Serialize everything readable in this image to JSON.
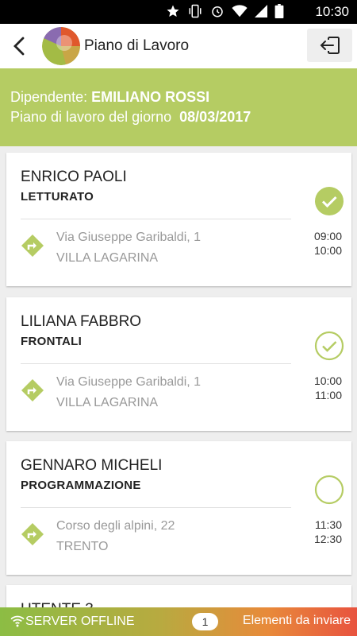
{
  "status_bar": {
    "time": "10:30"
  },
  "app_bar": {
    "title": "Piano di Lavoro"
  },
  "header": {
    "employee_label": "Dipendente:",
    "employee_name": "EMILIANO ROSSI",
    "plan_label": "Piano di lavoro del giorno",
    "plan_date": "08/03/2017"
  },
  "appointments": [
    {
      "name": "ENRICO PAOLI",
      "type": "LETTURATO",
      "street": "Via Giuseppe Garibaldi, 1",
      "city": "VILLA LAGARINA",
      "time_start": "09:00",
      "time_end": "10:00",
      "status": "completed"
    },
    {
      "name": "LILIANA FABBRO",
      "type": "FRONTALI",
      "street": "Via Giuseppe Garibaldi, 1",
      "city": "VILLA LAGARINA",
      "time_start": "10:00",
      "time_end": "11:00",
      "status": "checked"
    },
    {
      "name": "GENNARO MICHELI",
      "type": "PROGRAMMAZIONE",
      "street": "Corso degli alpini, 22",
      "city": "TRENTO",
      "time_start": "11:30",
      "time_end": "12:30",
      "status": "pending"
    },
    {
      "name": "UTENTE 3"
    }
  ],
  "footer": {
    "server_status": "SERVER OFFLINE",
    "pending_count": "1",
    "pending_label": "Elementi da inviare"
  },
  "colors": {
    "accent": "#b5cc63",
    "footer_start": "#8cbd44",
    "footer_end": "#e8533f"
  }
}
